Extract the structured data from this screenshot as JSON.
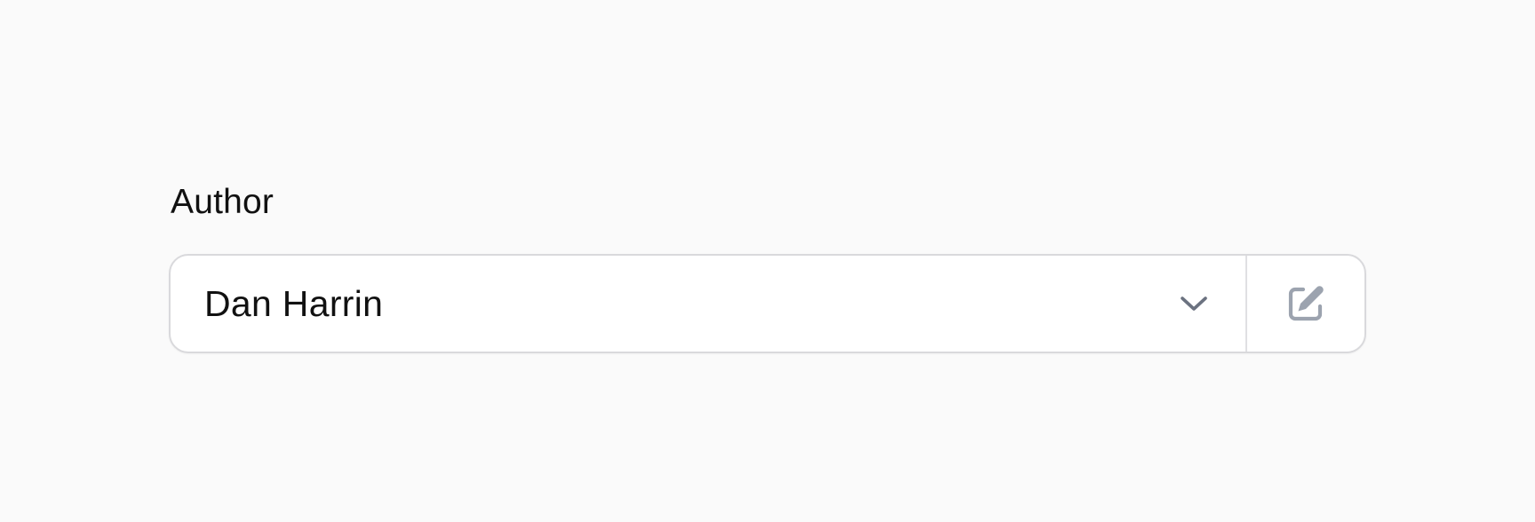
{
  "field": {
    "label": "Author",
    "selected_value": "Dan Harrin"
  },
  "icons": {
    "dropdown": "chevron-down-icon",
    "edit": "pencil-square-icon"
  },
  "colors": {
    "background": "#fafafa",
    "border": "#d9d9dc",
    "icon_gray": "#9ca3af",
    "chevron_gray": "#6b7280",
    "text": "#111111"
  }
}
